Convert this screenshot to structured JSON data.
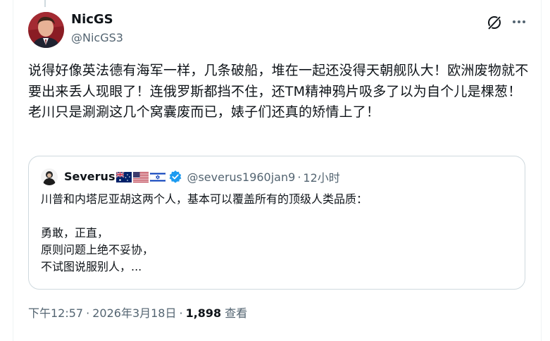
{
  "author": {
    "display_name": "NicGS",
    "handle": "@NicGS3"
  },
  "tweet": {
    "text": "说得好像英法德有海军一样，几条破船，堆在一起还没得天朝舰队大！欧洲废物就不要出来丢人现眼了！连俄罗斯都挡不住，还TM精神鸦片吸多了以为自个儿是棵葱！老川只是涮涮这几个窝囊废而已，婊子们还真的矫情上了！"
  },
  "quote": {
    "display_name": "Severus",
    "flags": [
      "australia-flag",
      "usa-flag",
      "israel-flag"
    ],
    "handle": "@severus1960jan9",
    "separator": "·",
    "time": "12小时",
    "lines": [
      "川普和内塔尼亚胡这两个人，基本可以覆盖所有的顶级人类品质：",
      "",
      "勇敢，正直，",
      "原则问题上绝不妥协，",
      "不试图说服别人，..."
    ]
  },
  "meta": {
    "time": "下午12:57",
    "separator": "·",
    "date": "2026年3月18日",
    "views_count": "1,898",
    "views_label": "查看"
  },
  "colors": {
    "text_primary": "#0f1419",
    "text_secondary": "#536471",
    "border": "#cfd9de",
    "verified_blue": "#1d9bf0"
  },
  "icons": {
    "grok": "grok-icon",
    "more": "more-dots-icon",
    "verified": "verified-badge-icon"
  }
}
